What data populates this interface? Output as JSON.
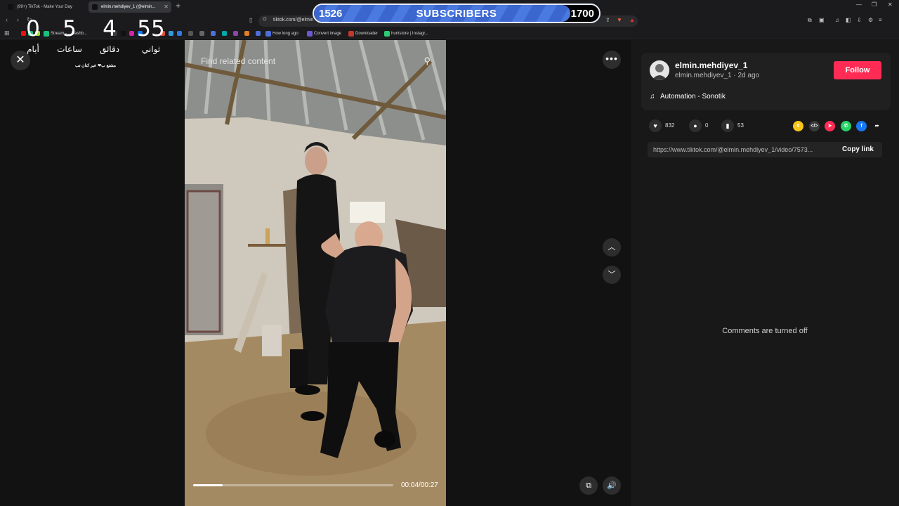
{
  "browser": {
    "tabs": [
      {
        "title": "(99+) TikTok - Make Your Day",
        "active": false
      },
      {
        "title": "elmin.mehdiyev_1 (@elmin...",
        "active": true
      }
    ],
    "url": "tiktok.com/@elmin",
    "bookmarks": [
      {
        "label": "Stream - ...Dashb...",
        "color": "#19c37d"
      },
      {
        "label": "How long ago",
        "color": "#4f6ed8"
      },
      {
        "label": "Convert image",
        "color": "#6a5acd"
      },
      {
        "label": "Downloader",
        "color": "#c0392b"
      },
      {
        "label": "huntstore | Instagr...",
        "color": "#2ecc71"
      }
    ]
  },
  "countdown": {
    "days": {
      "value": "0",
      "label": "أيام"
    },
    "hours": {
      "value": "5",
      "label": "ساعات"
    },
    "minutes": {
      "value": "4",
      "label": "دقائق"
    },
    "seconds": {
      "value": "55",
      "label": "ثواني"
    },
    "subtitle": "مشتع ب❤ عبر كنان تب"
  },
  "subscribers": {
    "current": "1526",
    "label": "SUBSCRIBERS",
    "goal": "1700",
    "progress": 0.898
  },
  "video": {
    "search_placeholder": "Find related content",
    "time": "00:04/00:27",
    "progress": 0.148
  },
  "creator": {
    "username": "elmin.mehdiyev_1",
    "handle": "elmin.mehdiyev_1",
    "age": "2d ago",
    "follow_label": "Follow",
    "music": "Automation - Sonotik"
  },
  "stats": {
    "likes": "832",
    "comments": "0",
    "saves": "53"
  },
  "share_icons": [
    {
      "name": "coin-share-icon",
      "color": "#f5c518",
      "glyph": "¢"
    },
    {
      "name": "embed-icon",
      "color": "#3a3a3a",
      "glyph": "</>"
    },
    {
      "name": "send-icon",
      "color": "#fe2c55",
      "glyph": "➤"
    },
    {
      "name": "whatsapp-icon",
      "color": "#25d366",
      "glyph": "✆"
    },
    {
      "name": "facebook-icon",
      "color": "#1877f2",
      "glyph": "f"
    },
    {
      "name": "share-arrow-icon",
      "color": "#181818",
      "glyph": "➦"
    }
  ],
  "link": {
    "url": "https://www.tiktok.com/@elmin.mehdiyev_1/video/7573...",
    "copy_label": "Copy link"
  },
  "comments_status": "Comments are turned off",
  "colors": {
    "follow": "#fe2c55",
    "subscriber_fill": "#3b66ce"
  }
}
